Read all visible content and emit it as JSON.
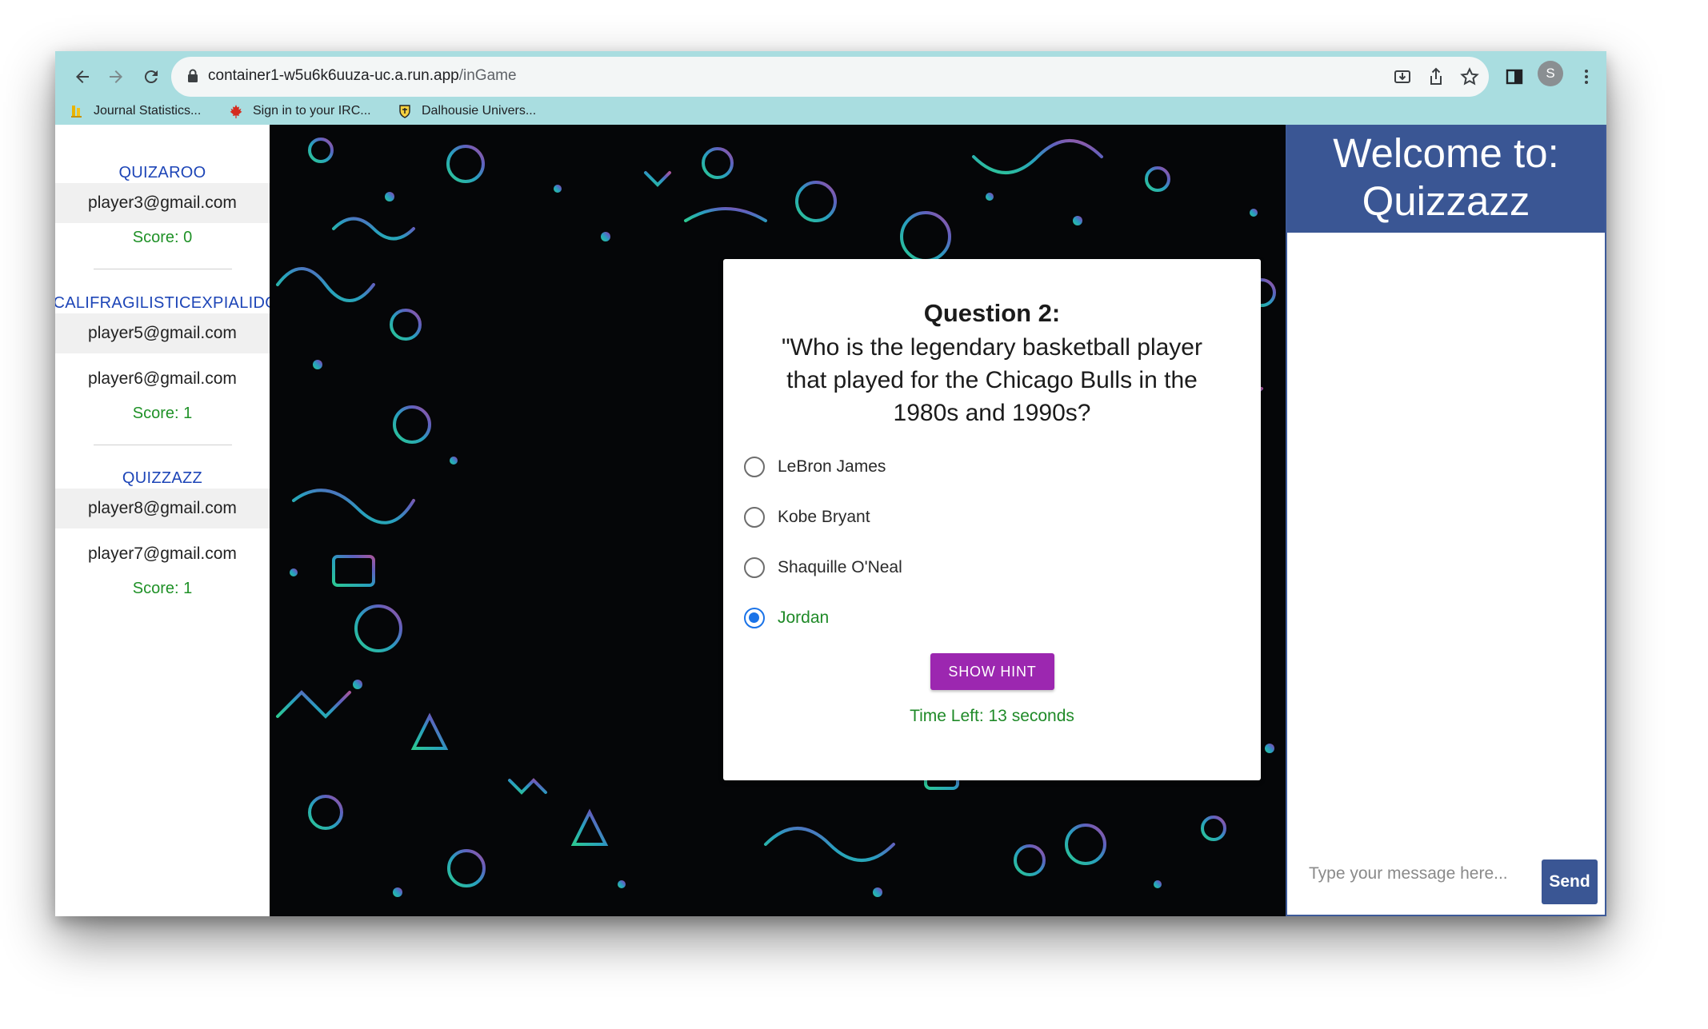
{
  "browser": {
    "url_host": "container1-w5u6k6uuza-uc.a.run.app",
    "url_path": "/inGame",
    "profile_initial": "S",
    "bookmarks": [
      {
        "label": "Journal Statistics...",
        "icon": "journal-icon"
      },
      {
        "label": "Sign in to your IRC...",
        "icon": "maple-leaf-icon"
      },
      {
        "label": "Dalhousie Univers...",
        "icon": "dalhousie-crest-icon"
      }
    ]
  },
  "teams": [
    {
      "name": "QUIZAROO",
      "players": [
        "player3@gmail.com"
      ],
      "score": "Score: 0"
    },
    {
      "name": "SUPERCALIFRAGILISTICEXPIALIDOCIOUS",
      "players": [
        "player5@gmail.com",
        "player6@gmail.com"
      ],
      "score": "Score: 1"
    },
    {
      "name": "QUIZZAZZ",
      "players": [
        "player8@gmail.com",
        "player7@gmail.com"
      ],
      "score": "Score: 1"
    }
  ],
  "question": {
    "title": "Question 2:",
    "text": "\"Who is the legendary basketball player that played for the Chicago Bulls in the 1980s and 1990s?",
    "options": [
      "LeBron James",
      "Kobe Bryant",
      "Shaquille O'Neal",
      "Jordan"
    ],
    "selected": "Jordan",
    "hint_label": "SHOW HINT",
    "timer_text": "Time Left: 13 seconds"
  },
  "chat": {
    "header": "Welcome to: Quizzazz",
    "placeholder": "Type your message here...",
    "send_label": "Send"
  },
  "colors": {
    "toolbar": "#a9dde0",
    "team_name": "#1d45b7",
    "score": "#1f9127",
    "hint_button": "#9c27b0",
    "chat_header": "#3a5694",
    "radio_checked": "#1a73e8"
  }
}
